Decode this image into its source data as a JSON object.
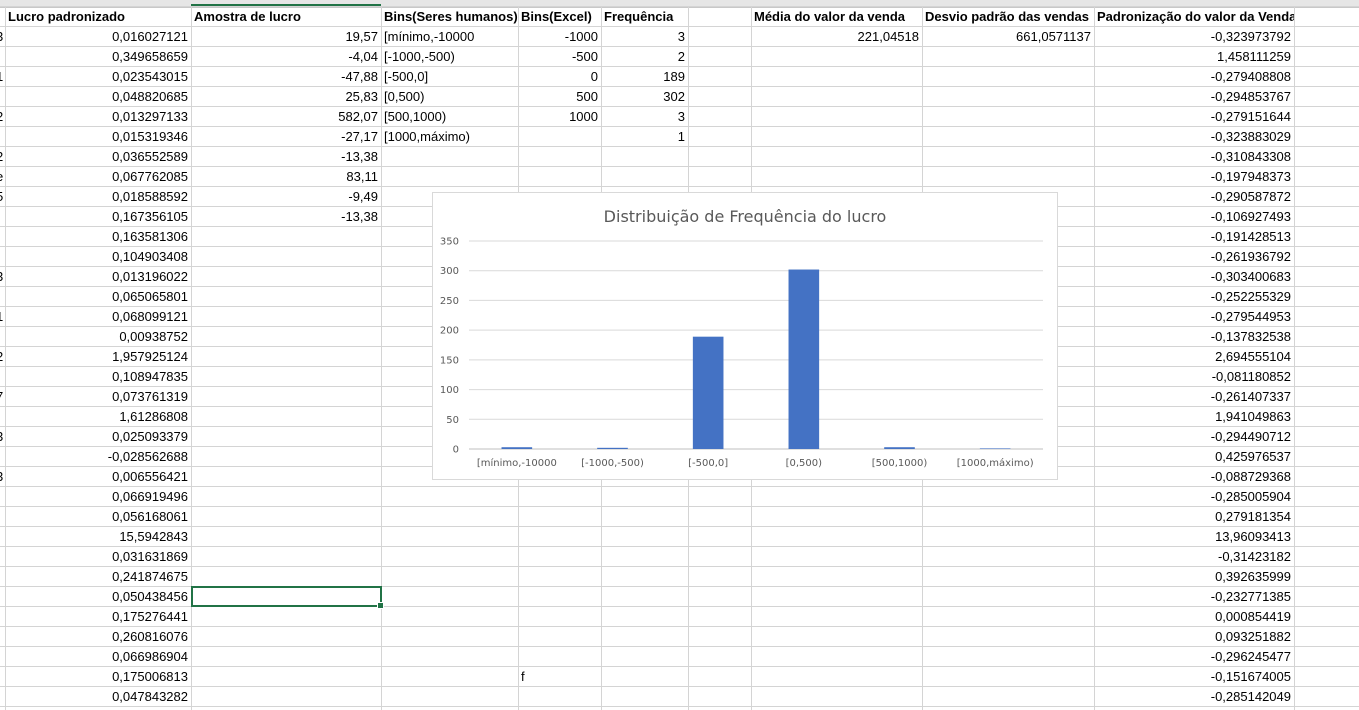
{
  "edge_chars": {
    "1": "3",
    "3": "1",
    "5": "2",
    "7": "2",
    "8": "e",
    "9": "5",
    "13": "3",
    "15": "1",
    "17": "2",
    "19": "7",
    "21": "3",
    "23": "3"
  },
  "headers": {
    "lucro_padronizado": "Lucro padronizado",
    "amostra_de_lucro": "Amostra de lucro",
    "bins_humanos": "Bins(Seres humanos)",
    "bins_excel": "Bins(Excel)",
    "frequencia": "Frequência",
    "media": "Média do valor da venda",
    "desvio": "Desvio padrão das vendas",
    "padronizacao": "Padronização do valor da Venda"
  },
  "lucro_padronizado": [
    "0,016027121",
    "0,349658659",
    "0,023543015",
    "0,048820685",
    "0,013297133",
    "0,015319346",
    "0,036552589",
    "0,067762085",
    "0,018588592",
    "0,167356105",
    "0,163581306",
    "0,104903408",
    "0,013196022",
    "0,065065801",
    "0,068099121",
    "0,00938752",
    "1,957925124",
    "0,108947835",
    "0,073761319",
    "1,61286808",
    "0,025093379",
    "-0,028562688",
    "0,006556421",
    "0,066919496",
    "0,056168061",
    "15,5942843",
    "0,031631869",
    "0,241874675",
    "0,050438456",
    "0,175276441",
    "0,260816076",
    "0,066986904",
    "0,175006813",
    "0,047843282"
  ],
  "amostra_de_lucro": [
    "19,57",
    "-4,04",
    "-47,88",
    "25,83",
    "582,07",
    "-27,17",
    "-13,38",
    "83,11",
    "-9,49",
    "-13,38"
  ],
  "bins_humanos": [
    "[mínimo,-10000",
    "[-1000,-500)",
    "[-500,0]",
    "[0,500)",
    "[500,1000)",
    "[1000,máximo)"
  ],
  "bins_excel": [
    "-1000",
    "-500",
    "0",
    "500",
    "1000"
  ],
  "frequencia": [
    "3",
    "2",
    "189",
    "302",
    "3",
    "1"
  ],
  "media": "221,04518",
  "desvio": "661,0571137",
  "padronizacao": [
    "-0,323973792",
    "1,458111259",
    "-0,279408808",
    "-0,294853767",
    "-0,279151644",
    "-0,323883029",
    "-0,310843308",
    "-0,197948373",
    "-0,290587872",
    "-0,106927493",
    "-0,191428513",
    "-0,261936792",
    "-0,303400683",
    "-0,252255329",
    "-0,279544953",
    "-0,137832538",
    "2,694555104",
    "-0,081180852",
    "-0,261407337",
    "1,941049863",
    "-0,294490712",
    "0,425976537",
    "-0,088729368",
    "-0,285005904",
    "0,279181354",
    "13,96093413",
    "-0,31423182",
    "0,392635999",
    "-0,232771385",
    "0,000854419",
    "0,093251882",
    "-0,296245477",
    "-0,151674005",
    "-0,285142049"
  ],
  "stray_text": "f",
  "chart_data": {
    "type": "bar",
    "title": "Distribuição de Frequência do lucro",
    "categories": [
      "[mínimo,-10000",
      "[-1000,-500)",
      "[-500,0]",
      "[0,500)",
      "[500,1000)",
      "[1000,máximo)"
    ],
    "values": [
      3,
      2,
      189,
      302,
      3,
      1
    ],
    "ylim": [
      0,
      350
    ],
    "yticks": [
      0,
      50,
      100,
      150,
      200,
      250,
      300,
      350
    ],
    "xlabel": "",
    "ylabel": "",
    "grid": true,
    "legend": "none",
    "color": "#4472c4"
  },
  "colors": {
    "excel_green": "#217346",
    "bar_blue": "#4472c4"
  }
}
